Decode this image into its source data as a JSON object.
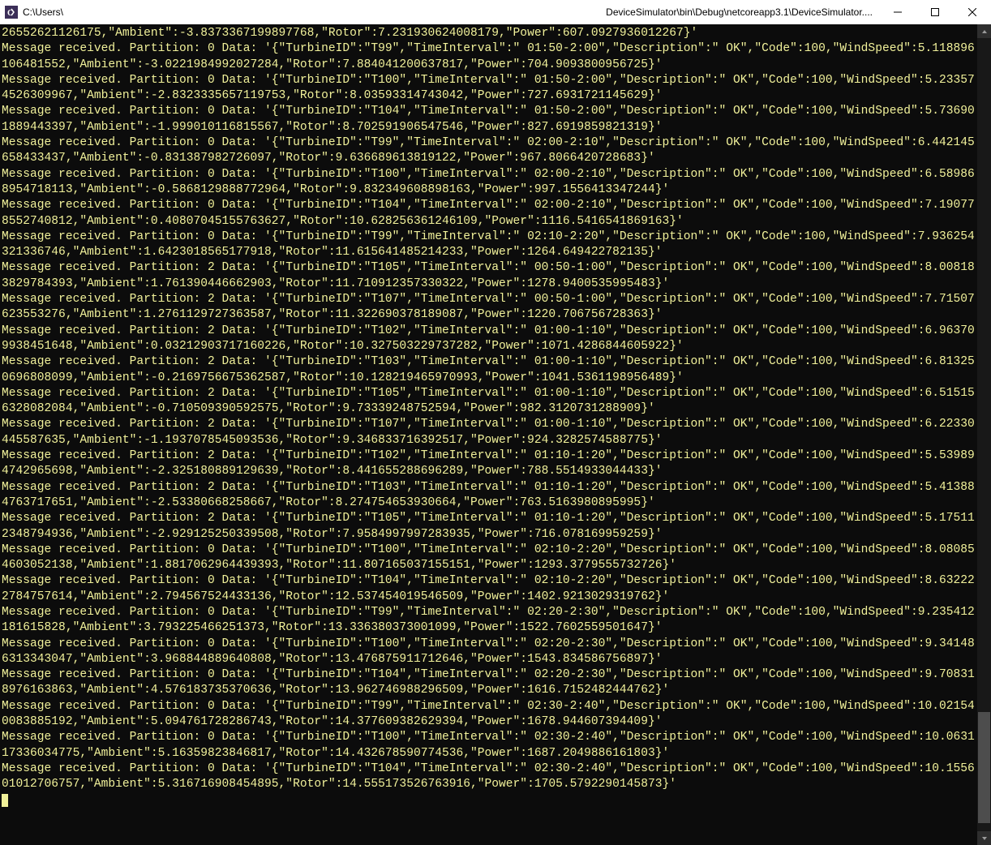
{
  "window": {
    "icon_name": "console-icon",
    "title_prefix": "C:\\Users\\",
    "title_obscured": "                                                                                                                     ",
    "title_suffix": "DeviceSimulator\\bin\\Debug\\netcoreapp3.1\\DeviceSimulator....",
    "minimize_tooltip": "Minimize",
    "maximize_tooltip": "Maximize",
    "close_tooltip": "Close"
  },
  "console": {
    "entries": [
      {
        "partition": 0,
        "continuation": true,
        "tail": "26552621126175,\"Ambient\":-3.8373367199897768,\"Rotor\":7.231930624008179,\"Power\":607.0927936012267}'"
      },
      {
        "partition": 0,
        "TurbineID": "T99",
        "TimeInterval": " 01:50-2:00",
        "Description": " OK",
        "Code": 100,
        "WindSpeed": "5.118896106481552",
        "Ambient": "-3.0221984992027284",
        "Rotor": "7.884041200637817",
        "Power": "704.9093800956725"
      },
      {
        "partition": 0,
        "TurbineID": "T100",
        "TimeInterval": " 01:50-2:00",
        "Description": " OK",
        "Code": 100,
        "WindSpeed": "5.233574526309967",
        "Ambient": "-2.8323335657119753",
        "Rotor": "8.03593314743042",
        "Power": "727.6931721145629"
      },
      {
        "partition": 0,
        "TurbineID": "T104",
        "TimeInterval": " 01:50-2:00",
        "Description": " OK",
        "Code": 100,
        "WindSpeed": "5.736901889443397",
        "Ambient": "-1.999010116815567",
        "Rotor": "8.702591906547546",
        "Power": "827.6919859821319"
      },
      {
        "partition": 0,
        "TurbineID": "T99",
        "TimeInterval": " 02:00-2:10",
        "Description": " OK",
        "Code": 100,
        "WindSpeed": "6.442145658433437",
        "Ambient": "-0.831387982726097",
        "Rotor": "9.636689613819122",
        "Power": "967.8066420728683"
      },
      {
        "partition": 0,
        "TurbineID": "T100",
        "TimeInterval": " 02:00-2:10",
        "Description": " OK",
        "Code": 100,
        "WindSpeed": "6.589868954718113",
        "Ambient": "-0.5868129888772964",
        "Rotor": "9.832349608898163",
        "Power": "997.1556413347244"
      },
      {
        "partition": 0,
        "TurbineID": "T104",
        "TimeInterval": " 02:00-2:10",
        "Description": " OK",
        "Code": 100,
        "WindSpeed": "7.190778552740812",
        "Ambient": "0.40807045155763627",
        "Rotor": "10.628256361246109",
        "Power": "1116.5416541869163"
      },
      {
        "partition": 0,
        "TurbineID": "T99",
        "TimeInterval": " 02:10-2:20",
        "Description": " OK",
        "Code": 100,
        "WindSpeed": "7.936254321336746",
        "Ambient": "1.6423018565177918",
        "Rotor": "11.615641485214233",
        "Power": "1264.649422782135"
      },
      {
        "partition": 2,
        "TurbineID": "T105",
        "TimeInterval": " 00:50-1:00",
        "Description": " OK",
        "Code": 100,
        "WindSpeed": "8.008183829784393",
        "Ambient": "1.761390446662903",
        "Rotor": "11.710912357330322",
        "Power": "1278.9400535995483"
      },
      {
        "partition": 2,
        "TurbineID": "T107",
        "TimeInterval": " 00:50-1:00",
        "Description": " OK",
        "Code": 100,
        "WindSpeed": "7.71507623553276",
        "Ambient": "1.2761129727363587",
        "Rotor": "11.322690378189087",
        "Power": "1220.706756728363"
      },
      {
        "partition": 2,
        "TurbineID": "T102",
        "TimeInterval": " 01:00-1:10",
        "Description": " OK",
        "Code": 100,
        "WindSpeed": "6.963709938451648",
        "Ambient": "0.03212903717160226",
        "Rotor": "10.327503229737282",
        "Power": "1071.4286844605922"
      },
      {
        "partition": 2,
        "TurbineID": "T103",
        "TimeInterval": " 01:00-1:10",
        "Description": " OK",
        "Code": 100,
        "WindSpeed": "6.813250696808099",
        "Ambient": "-0.2169756675362587",
        "Rotor": "10.128219465970993",
        "Power": "1041.5361198956489"
      },
      {
        "partition": 2,
        "TurbineID": "T105",
        "TimeInterval": " 01:00-1:10",
        "Description": " OK",
        "Code": 100,
        "WindSpeed": "6.515156328082084",
        "Ambient": "-0.710509390592575",
        "Rotor": "9.73339248752594",
        "Power": "982.3120731288909"
      },
      {
        "partition": 2,
        "TurbineID": "T107",
        "TimeInterval": " 01:00-1:10",
        "Description": " OK",
        "Code": 100,
        "WindSpeed": "6.22330445587635",
        "Ambient": "-1.1937078545093536",
        "Rotor": "9.346833716392517",
        "Power": "924.3282574588775"
      },
      {
        "partition": 2,
        "TurbineID": "T102",
        "TimeInterval": " 01:10-1:20",
        "Description": " OK",
        "Code": 100,
        "WindSpeed": "5.539894742965698",
        "Ambient": "-2.325180889129639",
        "Rotor": "8.441655288696289",
        "Power": "788.5514933044433"
      },
      {
        "partition": 2,
        "TurbineID": "T103",
        "TimeInterval": " 01:10-1:20",
        "Description": " OK",
        "Code": 100,
        "WindSpeed": "5.413884763717651",
        "Ambient": "-2.53380668258667",
        "Rotor": "8.274754653930664",
        "Power": "763.5163980895995"
      },
      {
        "partition": 2,
        "TurbineID": "T105",
        "TimeInterval": " 01:10-1:20",
        "Description": " OK",
        "Code": 100,
        "WindSpeed": "5.175112348794936",
        "Ambient": "-2.929125250339508",
        "Rotor": "7.9584997997283935",
        "Power": "716.078169959259"
      },
      {
        "partition": 0,
        "TurbineID": "T100",
        "TimeInterval": " 02:10-2:20",
        "Description": " OK",
        "Code": 100,
        "WindSpeed": "8.080854603052138",
        "Ambient": "1.8817062964439393",
        "Rotor": "11.807165037155151",
        "Power": "1293.3779555732726"
      },
      {
        "partition": 0,
        "TurbineID": "T104",
        "TimeInterval": " 02:10-2:20",
        "Description": " OK",
        "Code": 100,
        "WindSpeed": "8.632222784757614",
        "Ambient": "2.794567524433136",
        "Rotor": "12.537454019546509",
        "Power": "1402.9213029319762"
      },
      {
        "partition": 0,
        "TurbineID": "T99",
        "TimeInterval": " 02:20-2:30",
        "Description": " OK",
        "Code": 100,
        "WindSpeed": "9.235412181615828",
        "Ambient": "3.793225466251373",
        "Rotor": "13.336380373001099",
        "Power": "1522.7602559501647"
      },
      {
        "partition": 0,
        "TurbineID": "T100",
        "TimeInterval": " 02:20-2:30",
        "Description": " OK",
        "Code": 100,
        "WindSpeed": "9.341486313343047",
        "Ambient": "3.968844889640808",
        "Rotor": "13.476875911712646",
        "Power": "1543.834586756897"
      },
      {
        "partition": 0,
        "TurbineID": "T104",
        "TimeInterval": " 02:20-2:30",
        "Description": " OK",
        "Code": 100,
        "WindSpeed": "9.708318976163863",
        "Ambient": "4.576183735370636",
        "Rotor": "13.962746988296509",
        "Power": "1616.7152482444762"
      },
      {
        "partition": 0,
        "TurbineID": "T99",
        "TimeInterval": " 02:30-2:40",
        "Description": " OK",
        "Code": 100,
        "WindSpeed": "10.021540083885192",
        "Ambient": "5.094761728286743",
        "Rotor": "14.377609382629394",
        "Power": "1678.944607394409"
      },
      {
        "partition": 0,
        "TurbineID": "T100",
        "TimeInterval": " 02:30-2:40",
        "Description": " OK",
        "Code": 100,
        "WindSpeed": "10.063117336034775",
        "Ambient": "5.16359823846817",
        "Rotor": "14.432678590774536",
        "Power": "1687.2049886161803"
      },
      {
        "partition": 0,
        "TurbineID": "T104",
        "TimeInterval": " 02:30-2:40",
        "Description": " OK",
        "Code": 100,
        "WindSpeed": "10.155601012706757",
        "Ambient": "5.316716908454895",
        "Rotor": "14.555173526763916",
        "Power": "1705.5792290145873"
      }
    ]
  }
}
